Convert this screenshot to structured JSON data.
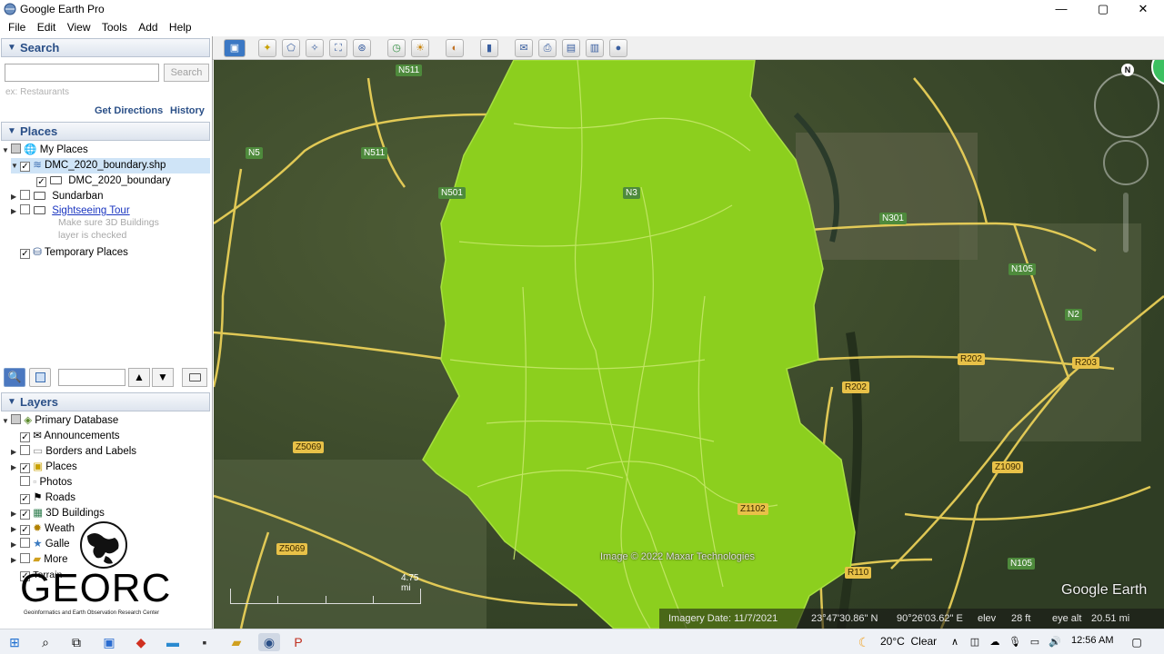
{
  "app": {
    "title": "Google Earth Pro"
  },
  "window": {
    "minimize": "—",
    "maximize": "▢",
    "close": "✕"
  },
  "menu": [
    "File",
    "Edit",
    "View",
    "Tools",
    "Add",
    "Help"
  ],
  "search": {
    "header": "Search",
    "placeholder": "ex: Restaurants",
    "button": "Search",
    "get_directions": "Get Directions",
    "history": "History"
  },
  "places": {
    "header": "Places",
    "my_places": "My Places",
    "items": [
      {
        "label": "DMC_2020_boundary.shp",
        "checked": true,
        "selected": true
      },
      {
        "label": "DMC_2020_boundary",
        "checked": true
      },
      {
        "label": "Sundarban",
        "checked": false
      },
      {
        "label": "Sightseeing Tour",
        "checked": false,
        "link": true
      }
    ],
    "hint_line1": "Make sure 3D Buildings",
    "hint_line2": "layer is checked",
    "temporary": "Temporary Places"
  },
  "layers": {
    "header": "Layers",
    "primary": "Primary Database",
    "items": [
      {
        "label": "Announcements",
        "checked": true
      },
      {
        "label": "Borders and Labels",
        "checked": false
      },
      {
        "label": "Places",
        "checked": true
      },
      {
        "label": "Photos",
        "checked": false
      },
      {
        "label": "Roads",
        "checked": true
      },
      {
        "label": "3D Buildings",
        "checked": true
      },
      {
        "label": "Weath",
        "checked": true
      },
      {
        "label": "Galle",
        "checked": false
      },
      {
        "label": "More",
        "checked": false
      },
      {
        "label": "Terrain",
        "checked": true
      }
    ]
  },
  "logo": {
    "text": "GEORC",
    "subtitle": "Geoinformatics and Earth Observation Research Center"
  },
  "map": {
    "copyright": "Image © 2022 Maxar Technologies",
    "scale": "4.75 mi",
    "imagery_date": "Imagery Date: 11/7/2021",
    "lat": "23°47'30.86\" N",
    "lon": "90°26'03.62\" E",
    "elev_label": "elev",
    "elev": "28 ft",
    "eye_alt_label": "eye alt",
    "eye_alt": "20.51 mi",
    "brand": "Google Earth",
    "compass_n": "N",
    "road_labels": [
      {
        "text": "N511",
        "kind": "n"
      },
      {
        "text": "N5",
        "kind": "n"
      },
      {
        "text": "N511",
        "kind": "n"
      },
      {
        "text": "N501",
        "kind": "n"
      },
      {
        "text": "N3",
        "kind": "n"
      },
      {
        "text": "N301",
        "kind": "n"
      },
      {
        "text": "N105",
        "kind": "n"
      },
      {
        "text": "N2",
        "kind": "n"
      },
      {
        "text": "R202",
        "kind": "y"
      },
      {
        "text": "R203",
        "kind": "y"
      },
      {
        "text": "R202",
        "kind": "y"
      },
      {
        "text": "Z5069",
        "kind": "y"
      },
      {
        "text": "Z1090",
        "kind": "y"
      },
      {
        "text": "Z1102",
        "kind": "y"
      },
      {
        "text": "Z5069",
        "kind": "y"
      },
      {
        "text": "R110",
        "kind": "y"
      },
      {
        "text": "N105",
        "kind": "n"
      }
    ]
  },
  "taskbar": {
    "weather": "20°C  Clear",
    "time": "12:56 AM"
  },
  "colors": {
    "boundary": "#8ccf1e",
    "road": "#f2d65a",
    "header": "#2a4f87"
  }
}
